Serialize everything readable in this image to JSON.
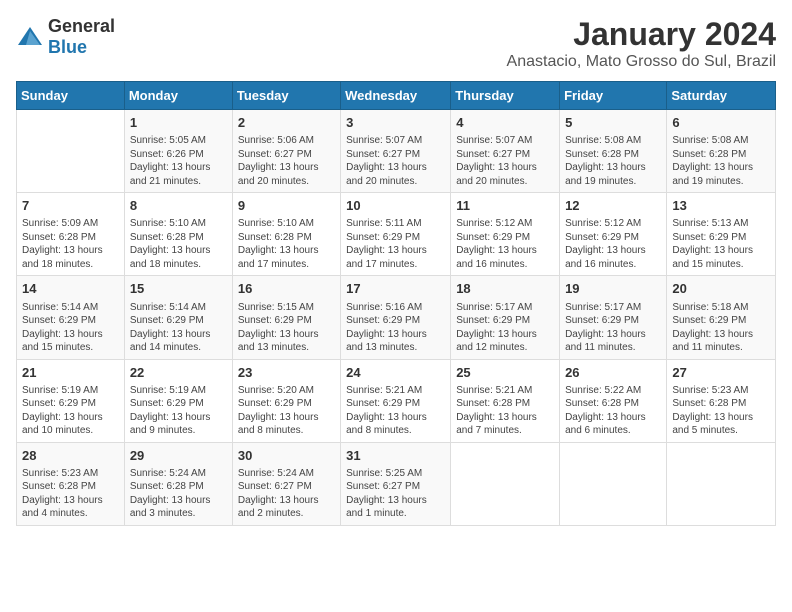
{
  "logo": {
    "general": "General",
    "blue": "Blue"
  },
  "title": "January 2024",
  "location": "Anastacio, Mato Grosso do Sul, Brazil",
  "headers": [
    "Sunday",
    "Monday",
    "Tuesday",
    "Wednesday",
    "Thursday",
    "Friday",
    "Saturday"
  ],
  "weeks": [
    [
      {
        "day": "",
        "info": ""
      },
      {
        "day": "1",
        "info": "Sunrise: 5:05 AM\nSunset: 6:26 PM\nDaylight: 13 hours\nand 21 minutes."
      },
      {
        "day": "2",
        "info": "Sunrise: 5:06 AM\nSunset: 6:27 PM\nDaylight: 13 hours\nand 20 minutes."
      },
      {
        "day": "3",
        "info": "Sunrise: 5:07 AM\nSunset: 6:27 PM\nDaylight: 13 hours\nand 20 minutes."
      },
      {
        "day": "4",
        "info": "Sunrise: 5:07 AM\nSunset: 6:27 PM\nDaylight: 13 hours\nand 20 minutes."
      },
      {
        "day": "5",
        "info": "Sunrise: 5:08 AM\nSunset: 6:28 PM\nDaylight: 13 hours\nand 19 minutes."
      },
      {
        "day": "6",
        "info": "Sunrise: 5:08 AM\nSunset: 6:28 PM\nDaylight: 13 hours\nand 19 minutes."
      }
    ],
    [
      {
        "day": "7",
        "info": "Sunrise: 5:09 AM\nSunset: 6:28 PM\nDaylight: 13 hours\nand 18 minutes."
      },
      {
        "day": "8",
        "info": "Sunrise: 5:10 AM\nSunset: 6:28 PM\nDaylight: 13 hours\nand 18 minutes."
      },
      {
        "day": "9",
        "info": "Sunrise: 5:10 AM\nSunset: 6:28 PM\nDaylight: 13 hours\nand 17 minutes."
      },
      {
        "day": "10",
        "info": "Sunrise: 5:11 AM\nSunset: 6:29 PM\nDaylight: 13 hours\nand 17 minutes."
      },
      {
        "day": "11",
        "info": "Sunrise: 5:12 AM\nSunset: 6:29 PM\nDaylight: 13 hours\nand 16 minutes."
      },
      {
        "day": "12",
        "info": "Sunrise: 5:12 AM\nSunset: 6:29 PM\nDaylight: 13 hours\nand 16 minutes."
      },
      {
        "day": "13",
        "info": "Sunrise: 5:13 AM\nSunset: 6:29 PM\nDaylight: 13 hours\nand 15 minutes."
      }
    ],
    [
      {
        "day": "14",
        "info": "Sunrise: 5:14 AM\nSunset: 6:29 PM\nDaylight: 13 hours\nand 15 minutes."
      },
      {
        "day": "15",
        "info": "Sunrise: 5:14 AM\nSunset: 6:29 PM\nDaylight: 13 hours\nand 14 minutes."
      },
      {
        "day": "16",
        "info": "Sunrise: 5:15 AM\nSunset: 6:29 PM\nDaylight: 13 hours\nand 13 minutes."
      },
      {
        "day": "17",
        "info": "Sunrise: 5:16 AM\nSunset: 6:29 PM\nDaylight: 13 hours\nand 13 minutes."
      },
      {
        "day": "18",
        "info": "Sunrise: 5:17 AM\nSunset: 6:29 PM\nDaylight: 13 hours\nand 12 minutes."
      },
      {
        "day": "19",
        "info": "Sunrise: 5:17 AM\nSunset: 6:29 PM\nDaylight: 13 hours\nand 11 minutes."
      },
      {
        "day": "20",
        "info": "Sunrise: 5:18 AM\nSunset: 6:29 PM\nDaylight: 13 hours\nand 11 minutes."
      }
    ],
    [
      {
        "day": "21",
        "info": "Sunrise: 5:19 AM\nSunset: 6:29 PM\nDaylight: 13 hours\nand 10 minutes."
      },
      {
        "day": "22",
        "info": "Sunrise: 5:19 AM\nSunset: 6:29 PM\nDaylight: 13 hours\nand 9 minutes."
      },
      {
        "day": "23",
        "info": "Sunrise: 5:20 AM\nSunset: 6:29 PM\nDaylight: 13 hours\nand 8 minutes."
      },
      {
        "day": "24",
        "info": "Sunrise: 5:21 AM\nSunset: 6:29 PM\nDaylight: 13 hours\nand 8 minutes."
      },
      {
        "day": "25",
        "info": "Sunrise: 5:21 AM\nSunset: 6:28 PM\nDaylight: 13 hours\nand 7 minutes."
      },
      {
        "day": "26",
        "info": "Sunrise: 5:22 AM\nSunset: 6:28 PM\nDaylight: 13 hours\nand 6 minutes."
      },
      {
        "day": "27",
        "info": "Sunrise: 5:23 AM\nSunset: 6:28 PM\nDaylight: 13 hours\nand 5 minutes."
      }
    ],
    [
      {
        "day": "28",
        "info": "Sunrise: 5:23 AM\nSunset: 6:28 PM\nDaylight: 13 hours\nand 4 minutes."
      },
      {
        "day": "29",
        "info": "Sunrise: 5:24 AM\nSunset: 6:28 PM\nDaylight: 13 hours\nand 3 minutes."
      },
      {
        "day": "30",
        "info": "Sunrise: 5:24 AM\nSunset: 6:27 PM\nDaylight: 13 hours\nand 2 minutes."
      },
      {
        "day": "31",
        "info": "Sunrise: 5:25 AM\nSunset: 6:27 PM\nDaylight: 13 hours\nand 1 minute."
      },
      {
        "day": "",
        "info": ""
      },
      {
        "day": "",
        "info": ""
      },
      {
        "day": "",
        "info": ""
      }
    ]
  ]
}
